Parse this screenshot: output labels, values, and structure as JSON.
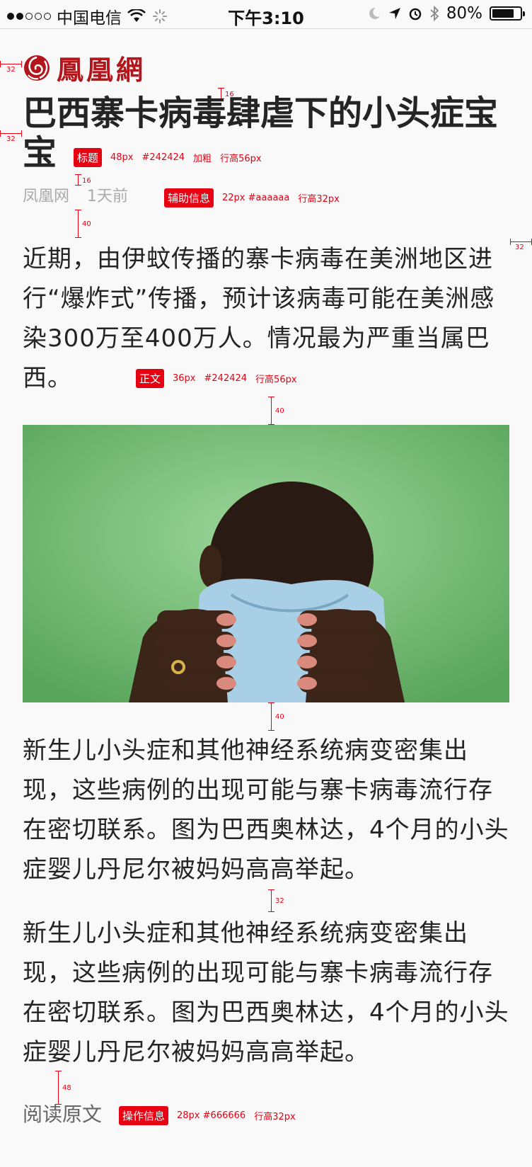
{
  "status_bar": {
    "carrier": "中国电信",
    "time": "下午3:10",
    "battery": "80%",
    "battery_level": 0.8
  },
  "logo": {
    "text": "鳳凰網"
  },
  "article": {
    "title": "巴西寨卡病毒肆虐下的小头症宝宝",
    "source": "凤凰网",
    "time_ago": "1天前",
    "lead": "近期，由伊蚊传播的寨卡病毒在美洲地区进行“爆炸式”传播，预计该病毒可能在美洲感染300万至400万人。情况最为严重当属巴西。",
    "caption": "新生儿小头症和其他神经系统病变密集出现，这些病例的出现可能与寨卡病毒流行存在密切联系。图为巴西奥林达，4个月的小头症婴儿丹尼尔被妈妈高高举起。",
    "paragraph2": "新生儿小头症和其他神经系统病变密集出现，这些病例的出现可能与寨卡病毒流行存在密切联系。图为巴西奥林达，4个月的小头症婴儿丹尼尔被妈妈高高举起。",
    "read_original": "阅读原文"
  },
  "annotations": {
    "title": {
      "tag": "标题",
      "size": "48px",
      "color": "#242424",
      "weight": "加粗",
      "line_height": "行高56px"
    },
    "meta": {
      "tag": "辅助信息",
      "size": "22px",
      "color": "#aaaaaa",
      "line_height": "行高32px"
    },
    "body": {
      "tag": "正文",
      "size": "36px",
      "color": "#242424",
      "line_height": "行高56px"
    },
    "action": {
      "tag": "操作信息",
      "size": "28px",
      "color": "#666666",
      "line_height": "行高32px"
    },
    "spacing": {
      "logo_left": "32",
      "title_top": "16",
      "title_left": "32",
      "meta_top": "16",
      "lead_top": "40",
      "right_margin": "32",
      "image_top": "40",
      "caption_top": "40",
      "para2_top": "32",
      "read_top": "48"
    }
  },
  "colors": {
    "brand": "#b3151c",
    "annotation": "#e60012",
    "title_text": "#242424",
    "meta_text": "#aaaaaa",
    "action_text": "#666666"
  }
}
